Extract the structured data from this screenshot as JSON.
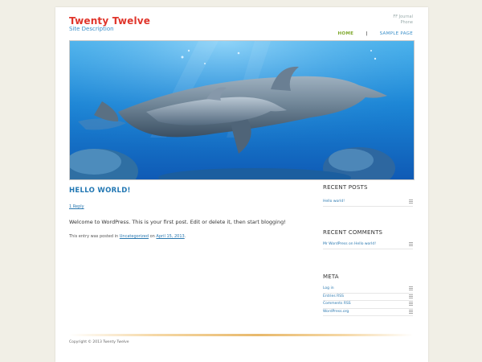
{
  "site": {
    "title": "Twenty Twelve",
    "description": "Site Description"
  },
  "header_links": [
    "FF Journal",
    "Phone"
  ],
  "nav": {
    "home": "HOME",
    "separator": "|",
    "sample": "SAMPLE PAGE"
  },
  "post": {
    "title": "HELLO WORLD!",
    "reply": "1 Reply",
    "content": "Welcome to WordPress. This is your first post. Edit or delete it, then start blogging!",
    "meta_prefix": "This entry was posted in",
    "category": "Uncategorized",
    "meta_on": "on",
    "date": "April 15, 2013",
    "meta_end": "."
  },
  "sidebar": {
    "recent_posts": {
      "title": "RECENT POSTS",
      "items": [
        "Hello world!"
      ]
    },
    "recent_comments": {
      "title": "RECENT COMMENTS",
      "items": [
        "Mr WordPress on Hello world!"
      ]
    },
    "meta": {
      "title": "META",
      "items": [
        "Log in",
        "Entries RSS",
        "Comments RSS",
        "WordPress.org"
      ]
    }
  },
  "footer": {
    "text": "Copyright © 2013 Twenty Twelve"
  },
  "colors": {
    "title": "#e0352b",
    "link": "#2a78b0",
    "nav_active": "#7ea82b",
    "background": "#f1efe6"
  }
}
